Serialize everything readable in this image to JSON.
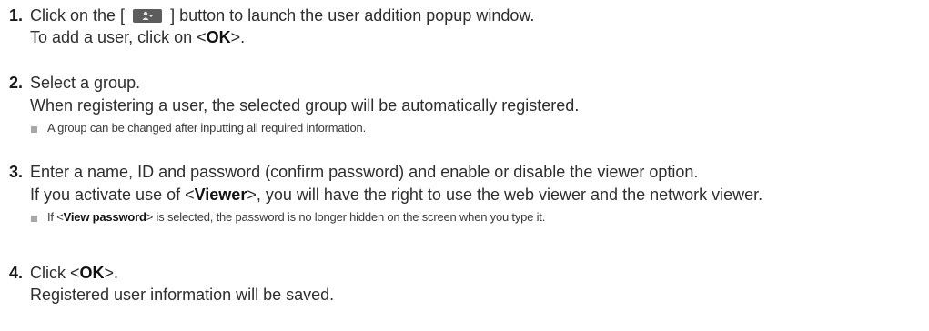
{
  "steps": [
    {
      "number": "1.",
      "line1_pre": "Click on the [",
      "line1_icon": "add-user-icon",
      "line1_post": "] button to launch the user addition popup window.",
      "line2_pre": "To add a user, click on <",
      "line2_bold": "OK",
      "line2_post": ">."
    },
    {
      "number": "2.",
      "line1": "Select a group.",
      "line2": "When registering a user, the selected group will be automatically registered.",
      "note": "A group can be changed after inputting all required information."
    },
    {
      "number": "3.",
      "line1": "Enter a name, ID and password (confirm password) and enable or disable the viewer option.",
      "line2_pre": "If you activate use of <",
      "line2_bold": "Viewer",
      "line2_post": ">, you will have the right to use the web viewer and the network viewer.",
      "note_pre": "If <",
      "note_bold": "View password",
      "note_post": "> is selected, the password is no longer hidden on the screen when you type it."
    },
    {
      "number": "4.",
      "line1_pre": "Click <",
      "line1_bold": "OK",
      "line1_post": ">.",
      "line2": "Registered user information will be saved."
    }
  ],
  "colors": {
    "text": "#2e2e2e",
    "bullet": "#a8a8a8",
    "icon_button": "#5c5c5c"
  }
}
